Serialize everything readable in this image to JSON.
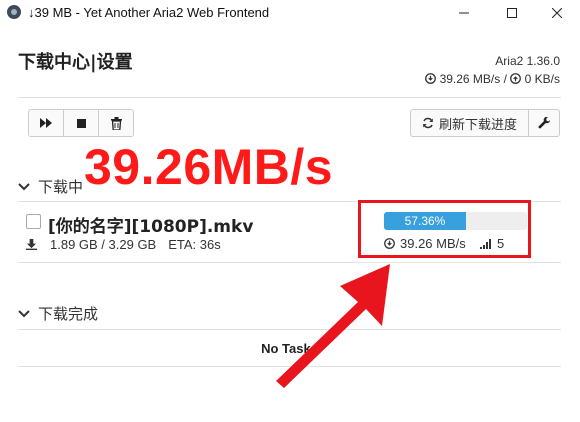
{
  "window": {
    "title": "↓39 MB - Yet Another Aria2 Web Frontend",
    "minimize": "—",
    "maximize": "☐",
    "close": "✕"
  },
  "header": {
    "title": "下载中心|设置",
    "version": "Aria2 1.36.0",
    "download_speed": "39.26 MB/s",
    "separator": "/",
    "upload_speed": "0 KB/s"
  },
  "toolbar": {
    "start_icon": "fast-forward-icon",
    "stop_icon": "stop-icon",
    "delete_icon": "trash-icon",
    "refresh_label": "刷新下载进度",
    "settings_icon": "wrench-icon"
  },
  "annotation": {
    "speed_text": "39.26MB/s",
    "color": "#ff1a1a"
  },
  "downloading": {
    "section_label": "下载中",
    "tasks": [
      {
        "name": "[你的名字][1080P].mkv",
        "size": "1.89 GB / 3.29 GB",
        "eta": "ETA: 36s",
        "progress_label": "57.36%",
        "progress": 0.5736,
        "speed": "39.26 MB/s",
        "connections": "5"
      }
    ]
  },
  "completed": {
    "section_label": "下载完成",
    "empty_text": "No Tasks"
  }
}
